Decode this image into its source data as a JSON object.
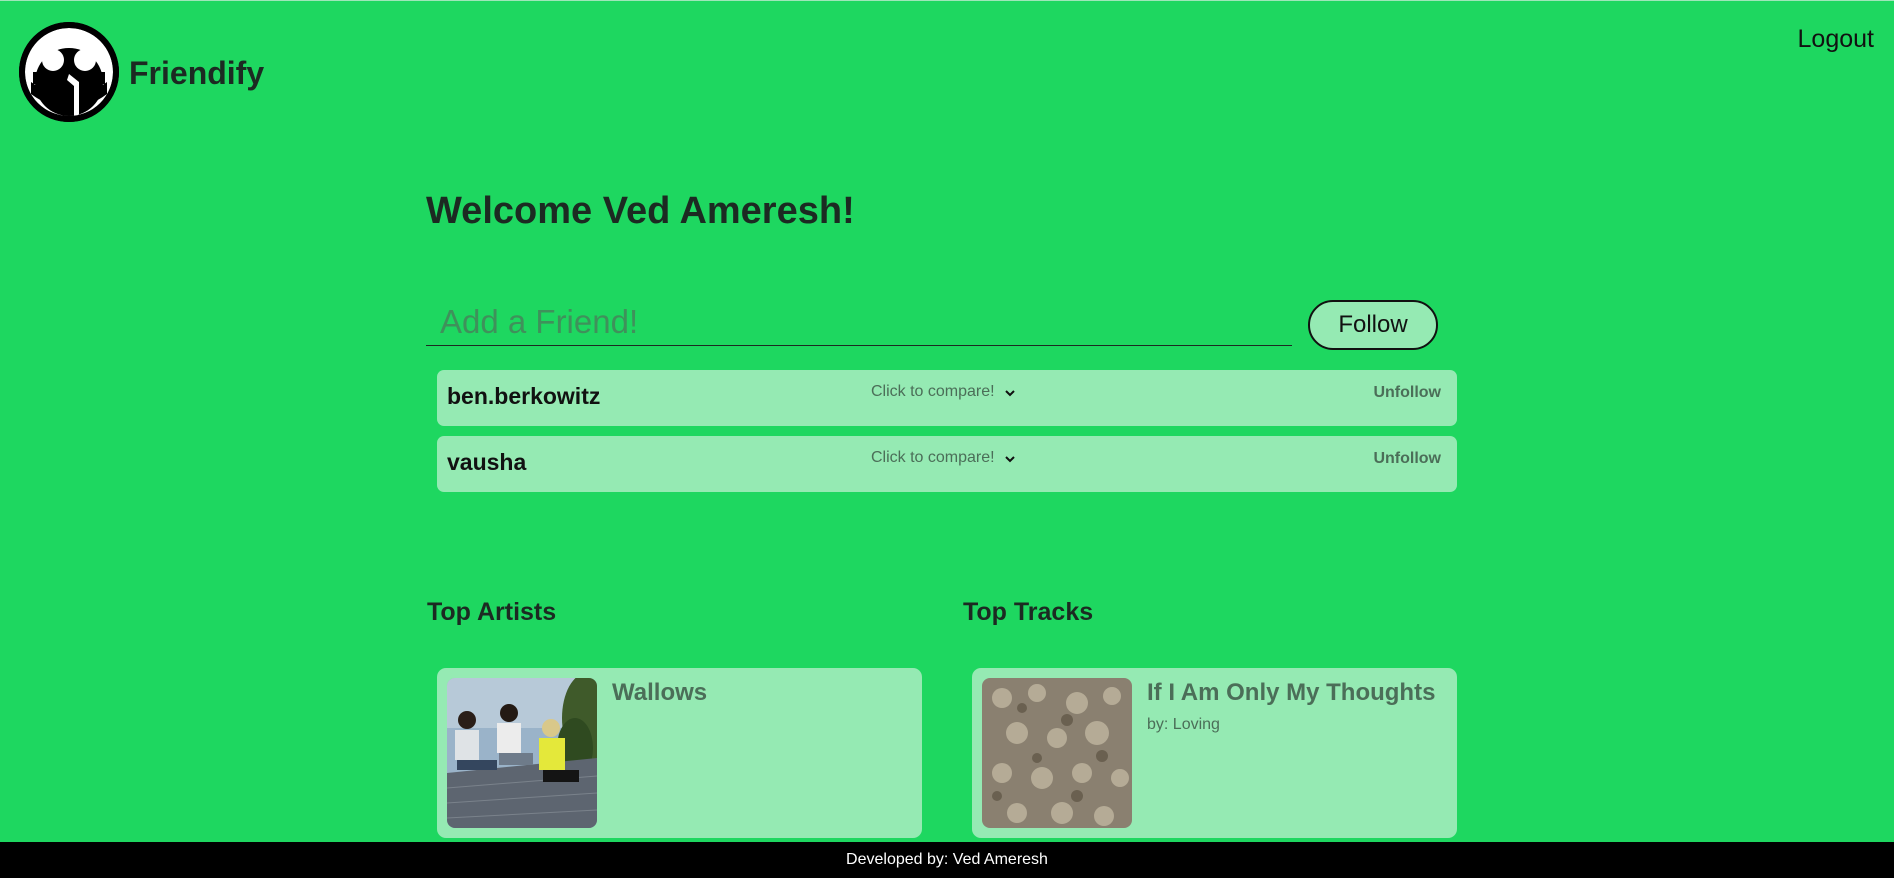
{
  "header": {
    "app_name": "Friendify",
    "logout_label": "Logout"
  },
  "main": {
    "welcome": "Welcome Ved Ameresh!",
    "add_friend_placeholder": "Add a Friend!",
    "follow_label": "Follow"
  },
  "friends": [
    {
      "name": "ben.berkowitz",
      "compare_label": "Click to compare!",
      "unfollow_label": "Unfollow"
    },
    {
      "name": "vausha",
      "compare_label": "Click to compare!",
      "unfollow_label": "Unfollow"
    }
  ],
  "top_artists": {
    "title": "Top Artists",
    "items": [
      {
        "name": "Wallows"
      }
    ]
  },
  "top_tracks": {
    "title": "Top Tracks",
    "items": [
      {
        "name": "If I Am Only My Thoughts",
        "by": "by: Loving"
      }
    ]
  },
  "footer": {
    "text": "Developed by: Ved Ameresh"
  },
  "colors": {
    "background": "#1ed760",
    "card": "#95eab3",
    "footer": "#000000",
    "muted_text": "#4b6e58"
  },
  "icons": {
    "logo": "friendify-face-logo-icon",
    "dropdown": "chevron-down-icon"
  }
}
